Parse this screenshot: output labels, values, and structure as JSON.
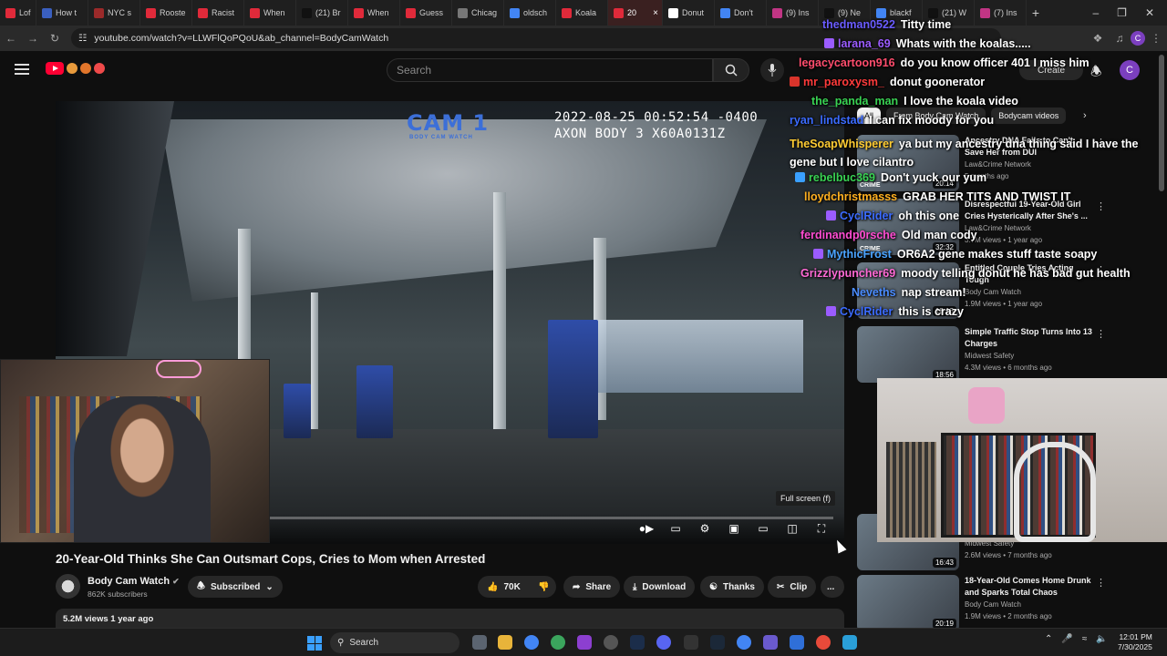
{
  "browser": {
    "tabs": [
      {
        "label": "Lof",
        "color": "#e02a3a"
      },
      {
        "label": "How t",
        "color": "#3a5fbf"
      },
      {
        "label": "NYC s",
        "color": "#9b2a2a"
      },
      {
        "label": "Rooste",
        "color": "#e02a3a"
      },
      {
        "label": "Racist",
        "color": "#e02a3a"
      },
      {
        "label": "When",
        "color": "#e02a3a"
      },
      {
        "label": "(21) Br",
        "color": "#111111"
      },
      {
        "label": "When",
        "color": "#e02a3a"
      },
      {
        "label": "Guess",
        "color": "#e02a3a"
      },
      {
        "label": "Chicag",
        "color": "#777777"
      },
      {
        "label": "oldsch",
        "color": "#4285f4"
      },
      {
        "label": "Koala",
        "color": "#e02a3a"
      },
      {
        "label": "20",
        "color": "#e02a3a",
        "active": true
      },
      {
        "label": "Donut",
        "color": "#ffffff"
      },
      {
        "label": "Don't",
        "color": "#4285f4"
      },
      {
        "label": "(9) Ins",
        "color": "#c13584"
      },
      {
        "label": "(9) Ne",
        "color": "#111111"
      },
      {
        "label": "blackf",
        "color": "#4285f4"
      },
      {
        "label": "(21) W",
        "color": "#111111"
      },
      {
        "label": "(7) Ins",
        "color": "#c13584"
      }
    ],
    "new_tab": "+",
    "url": "youtube.com/watch?v=LLWFlQoPQoU&ab_channel=BodyCamWatch",
    "profile_initial": "C"
  },
  "youtube": {
    "search_placeholder": "Search",
    "create_label": "Create",
    "avatar_initial": "C",
    "video": {
      "cam_label": "CAM 1",
      "cam_sub": "BODY CAM WATCH",
      "osd_line1": "2022-08-25 00:52:54 -0400",
      "osd_line2": "AXON BODY 3 X60A0131Z",
      "fullscreen_tooltip": "Full screen (f)"
    },
    "title": "20-Year-Old Thinks She Can Outsmart Cops, Cries to Mom when Arrested",
    "channel": {
      "name": "Body Cam Watch",
      "subs": "862K subscribers"
    },
    "subscribed_label": "Subscribed",
    "likes": "70K",
    "share_label": "Share",
    "download_label": "Download",
    "thanks_label": "Thanks",
    "clip_label": "Clip",
    "more_label": "...",
    "description_meta": "5.2M views  1 year ago",
    "chips": [
      "All",
      "From Body Cam Watch",
      "Bodycam videos"
    ],
    "recommendations": [
      {
        "title": "Ancestry DNA Fails to Can't Save Her from DUI",
        "channel": "Law&Crime Network",
        "meta": "5 months ago",
        "duration": "20:14",
        "crime": "CRIME"
      },
      {
        "title": "Disrespectful 19-Year-Old Girl Cries Hysterically After She's ...",
        "channel": "Law&Crime Network",
        "meta": "3.7M views • 1 year ago",
        "duration": "32:32",
        "crime": "CRIME"
      },
      {
        "title": "Entitled Couple Tries Acting Tough",
        "channel": "Body Cam Watch",
        "meta": "1.9M views • 1 year ago",
        "duration": "18:13",
        "crime": ""
      },
      {
        "title": "Simple Traffic Stop Turns Into 13 Charges",
        "channel": "Midwest Safety",
        "meta": "4.3M views • 6 months ago",
        "duration": "18:56",
        "crime": ""
      },
      {
        "title": "",
        "channel": "Midwest Safety",
        "meta": "2.6M views • 7 months ago",
        "duration": "16:43",
        "crime": ""
      },
      {
        "title": "18-Year-Old Comes Home Drunk and Sparks Total Chaos",
        "channel": "Body Cam Watch",
        "meta": "1.9M views • 2 months ago",
        "duration": "20:19",
        "crime": ""
      }
    ]
  },
  "chat": [
    {
      "user": "thedman0522",
      "text": "Titty time",
      "color": "#6a5cff",
      "badge": ""
    },
    {
      "user": "larana_69",
      "text": "Whats with the koalas.....",
      "color": "#9b5cff",
      "badge": "#9b5cff"
    },
    {
      "user": "legacycartoon916",
      "text": "do you know officer 401 I miss him",
      "color": "#ff4d6d",
      "badge": ""
    },
    {
      "user": "mr_paroxysm_",
      "text": "donut goonerator",
      "color": "#ff3b3b",
      "badge": "#d9342b"
    },
    {
      "user": "the_panda_man",
      "text": "I love the koala video",
      "color": "#39d353",
      "badge": ""
    },
    {
      "user": "ryan_lindstad",
      "text": "I can fix moody for you",
      "color": "#3b6bff",
      "badge": ""
    },
    {
      "user": "TheSoapWhisperer",
      "text": "ya but my ancestry dna thing said I have the gene but I love cilantro",
      "color": "#ffcc33",
      "badge": ""
    },
    {
      "user": "rebelbuc369",
      "text": "Don't yuck our yum",
      "color": "#39d353",
      "badge": "#3aa0ff"
    },
    {
      "user": "lloydchristmasss",
      "text": "GRAB HER TITS AND TWIST IT",
      "color": "#ffb020",
      "badge": ""
    },
    {
      "user": "CyclRider",
      "text": "oh this one",
      "color": "#3b6bff",
      "badge": "#9b5cff"
    },
    {
      "user": "ferdinandp0rsche",
      "text": "Old man cody",
      "color": "#ff4dd2",
      "badge": ""
    },
    {
      "user": "MythicFrost",
      "text": "OR6A2 gene makes stuff taste soapy",
      "color": "#4aa3ff",
      "badge": "#9b5cff"
    },
    {
      "user": "Grizzlypuncher69",
      "text": "moody telling donut he has bad gut health",
      "color": "#ff6ad5",
      "badge": ""
    },
    {
      "user": "Neveths",
      "text": "nap stream!",
      "color": "#4a8cff",
      "badge": ""
    },
    {
      "user": "CyclRider",
      "text": "this is crazy",
      "color": "#3b6bff",
      "badge": "#9b5cff"
    }
  ],
  "taskbar": {
    "search_label": "Search",
    "time": "12:01 PM",
    "date": "7/30/2025"
  }
}
